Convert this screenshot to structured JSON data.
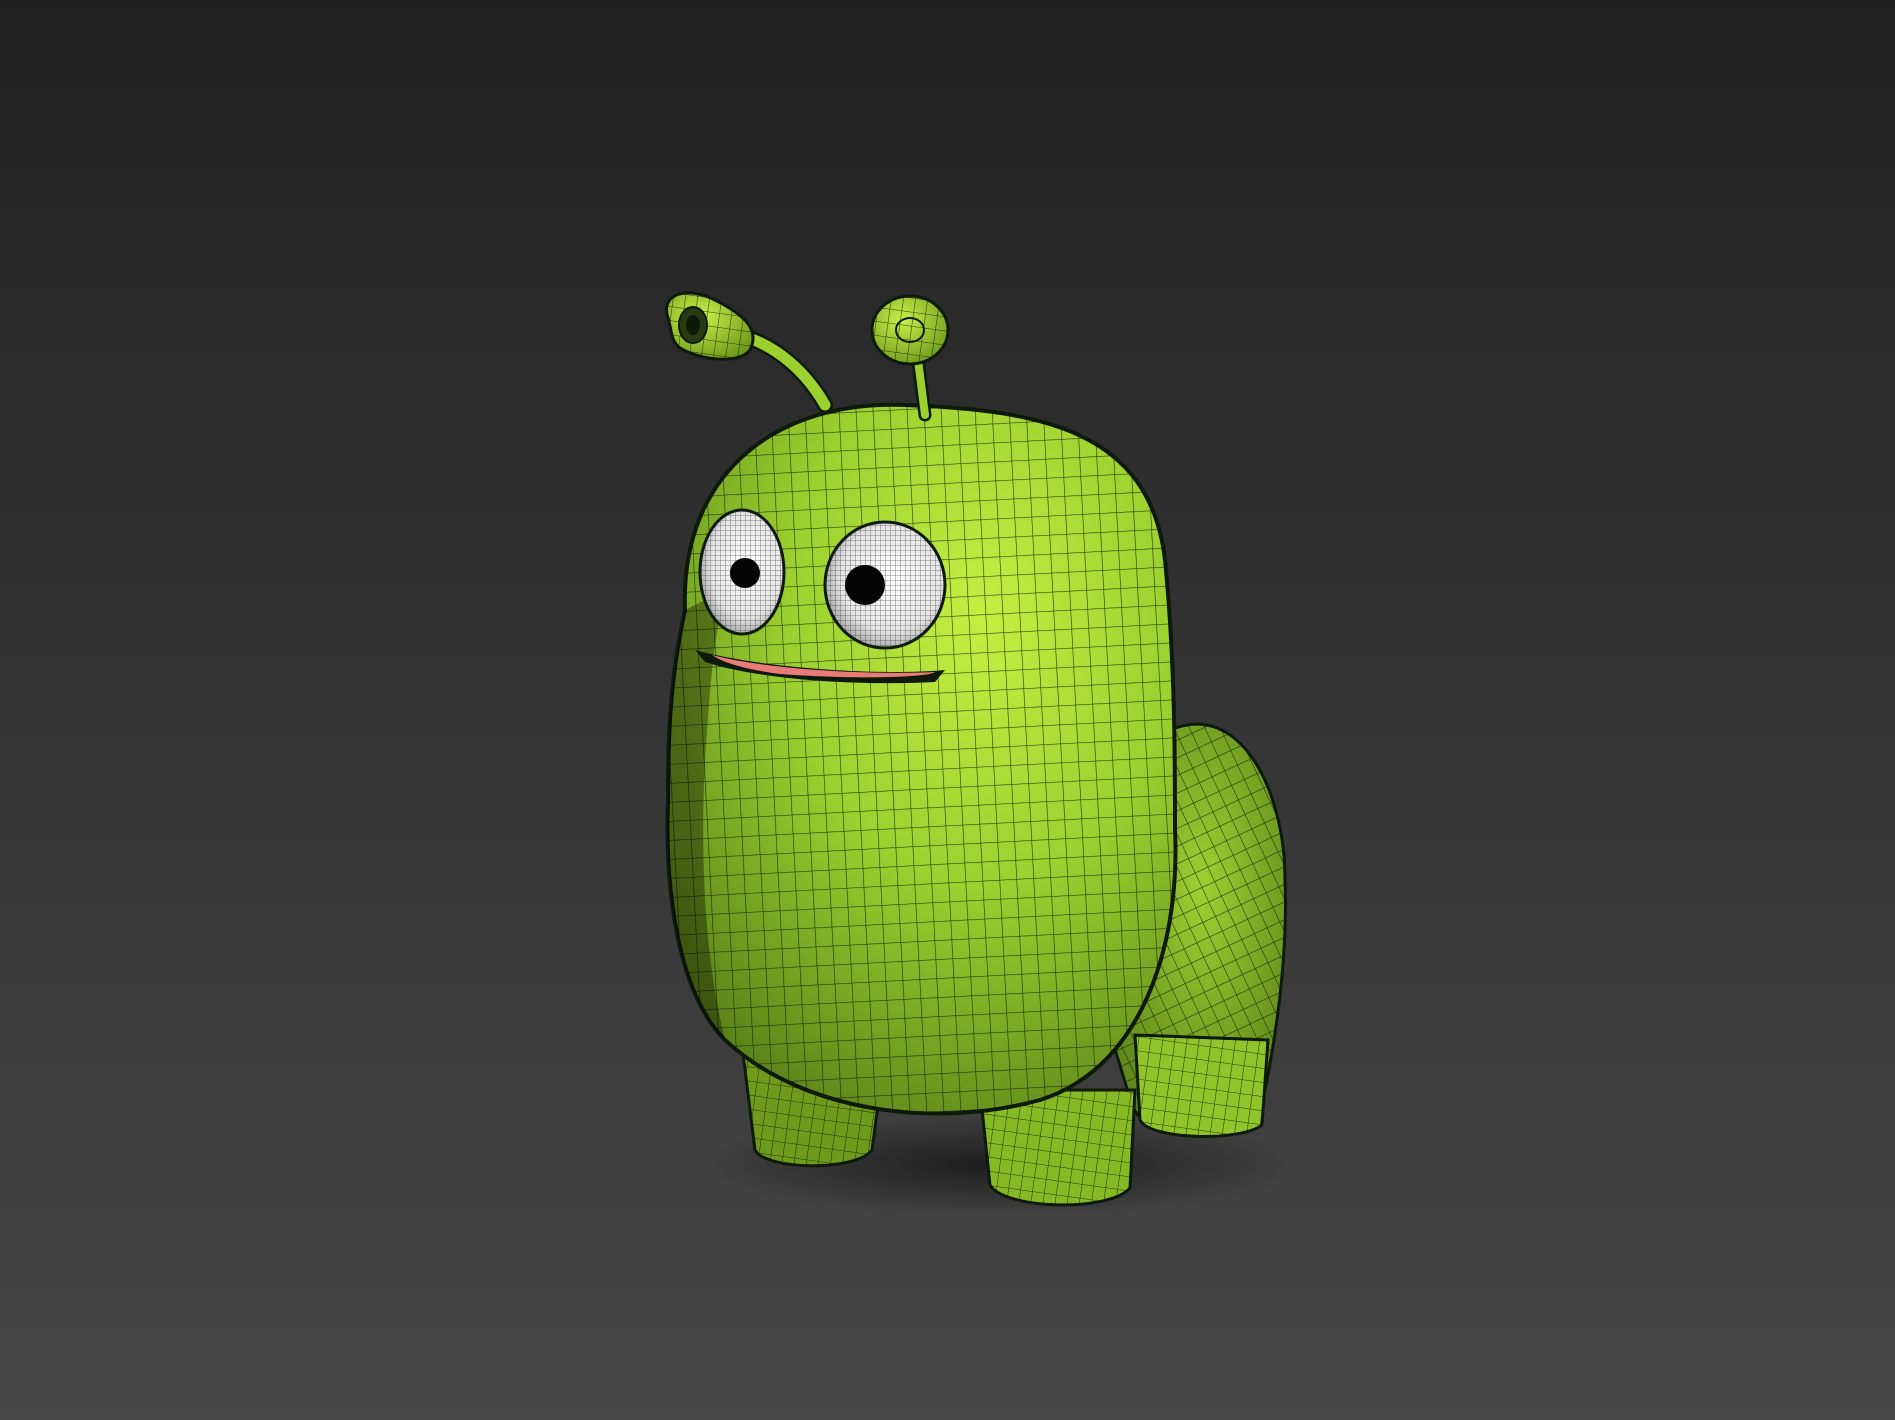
{
  "scene": {
    "subject": "green-alien-character-wireframe",
    "colors": {
      "background_top": "#212121",
      "background_bottom": "#474747",
      "body_light": "#b9ea3a",
      "body_mid": "#8fc52a",
      "body_dark": "#4f7614",
      "wire": "#0d1a0a",
      "eye_white": "#f2f2f2",
      "eye_shade": "#9a9a9a",
      "pupil": "#050505",
      "lip": "#e87b77"
    }
  }
}
